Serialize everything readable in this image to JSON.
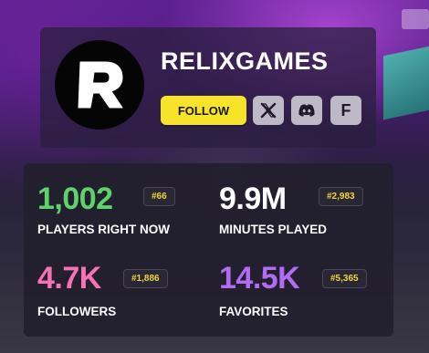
{
  "channel": {
    "name": "RELIXGAMES",
    "avatar_letter": "R"
  },
  "actions": {
    "follow_label": "FOLLOW",
    "social": [
      {
        "icon": "x-logo-icon"
      },
      {
        "icon": "discord-logo-icon"
      },
      {
        "icon": "f-letter-icon",
        "label": "F"
      }
    ]
  },
  "stats": {
    "players": {
      "value": "1,002",
      "rank": "#66",
      "label": "PLAYERS RIGHT NOW",
      "color": "#5ed36b"
    },
    "minutes": {
      "value": "9.9M",
      "rank": "#2,983",
      "label": "MINUTES PLAYED",
      "color": "#ffffff"
    },
    "followers": {
      "value": "4.7K",
      "rank": "#1,886",
      "label": "FOLLOWERS",
      "color": "#f572b6"
    },
    "favorites": {
      "value": "14.5K",
      "rank": "#5,365",
      "label": "FAVORITES",
      "color": "#b06cf2"
    }
  },
  "colors": {
    "follow_button": "#f6e32a",
    "rank_text": "#f2d43a"
  }
}
